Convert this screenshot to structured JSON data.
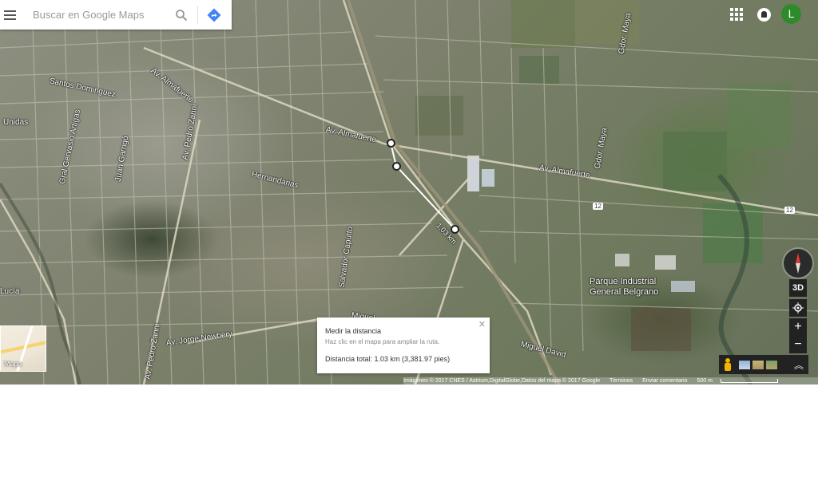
{
  "search": {
    "placeholder": "Buscar en Google Maps"
  },
  "header": {
    "user_initial": "L"
  },
  "icons": {
    "menu": "hamburger-menu-icon",
    "search": "search-icon",
    "directions": "directions-icon",
    "apps": "apps-grid-icon",
    "notifications": "notifications-icon",
    "compass": "compass-icon",
    "location": "my-location-icon",
    "pegman": "pegman-icon",
    "expand": "expand-icon",
    "close": "close-icon"
  },
  "colors": {
    "avatar": "#2f8a2c",
    "directions": "#4285f4",
    "compass_north": "#e53935",
    "measure_line": "#ffffff"
  },
  "street_labels": {
    "santos_dominguez": "Santos Dominguez",
    "av_almafuerte_nw": "Av. Almafuerte",
    "unidas": "Unidas",
    "gral_gervasio_artigas": "Gral Gervasio Artigas",
    "juan_garrigo": "Juan Garrigó",
    "av_pedro_zanni": "Av. Pedro Zanni",
    "av_almafuerte_center": "Av. Almafuerte",
    "hernandarias": "Hernandarias",
    "av_almafuerte_east": "Av. Almafuerte",
    "gdor_maya_north": "Gdor. Maya",
    "gdor_maya_south": "Gdor. Maya",
    "route_12_a": "12",
    "route_12_b": "12",
    "salvador_caputto": "Salvador Caputto",
    "miguel_david": "Miguel David",
    "av_pedro_zanni_south": "Av. Pedro Zanni",
    "av_jorge_newbery": "Av. Jorge Newbery",
    "lucia": "Lucía",
    "miquel": "Miquel",
    "parque_industrial_line1": "Parque Industrial",
    "parque_industrial_line2": "General Belgrano",
    "measure_label": "1.03 km"
  },
  "map_type": {
    "label": "Mapa"
  },
  "controls": {
    "tilt_label": "3D",
    "zoom_in": "+",
    "zoom_out": "−"
  },
  "measure": {
    "title": "Medir la distancia",
    "hint": "Haz clic en el mapa para ampliar la ruta.",
    "total": "Distancia total: 1.03 km (3,381.97 pies)"
  },
  "attribution": {
    "imagery": "Imágenes © 2017 CNES / Astrium,DigitalGlobe,Datos del mapa © 2017 Google",
    "terms": "Términos",
    "feedback": "Enviar comentario",
    "scale": "500 m"
  }
}
